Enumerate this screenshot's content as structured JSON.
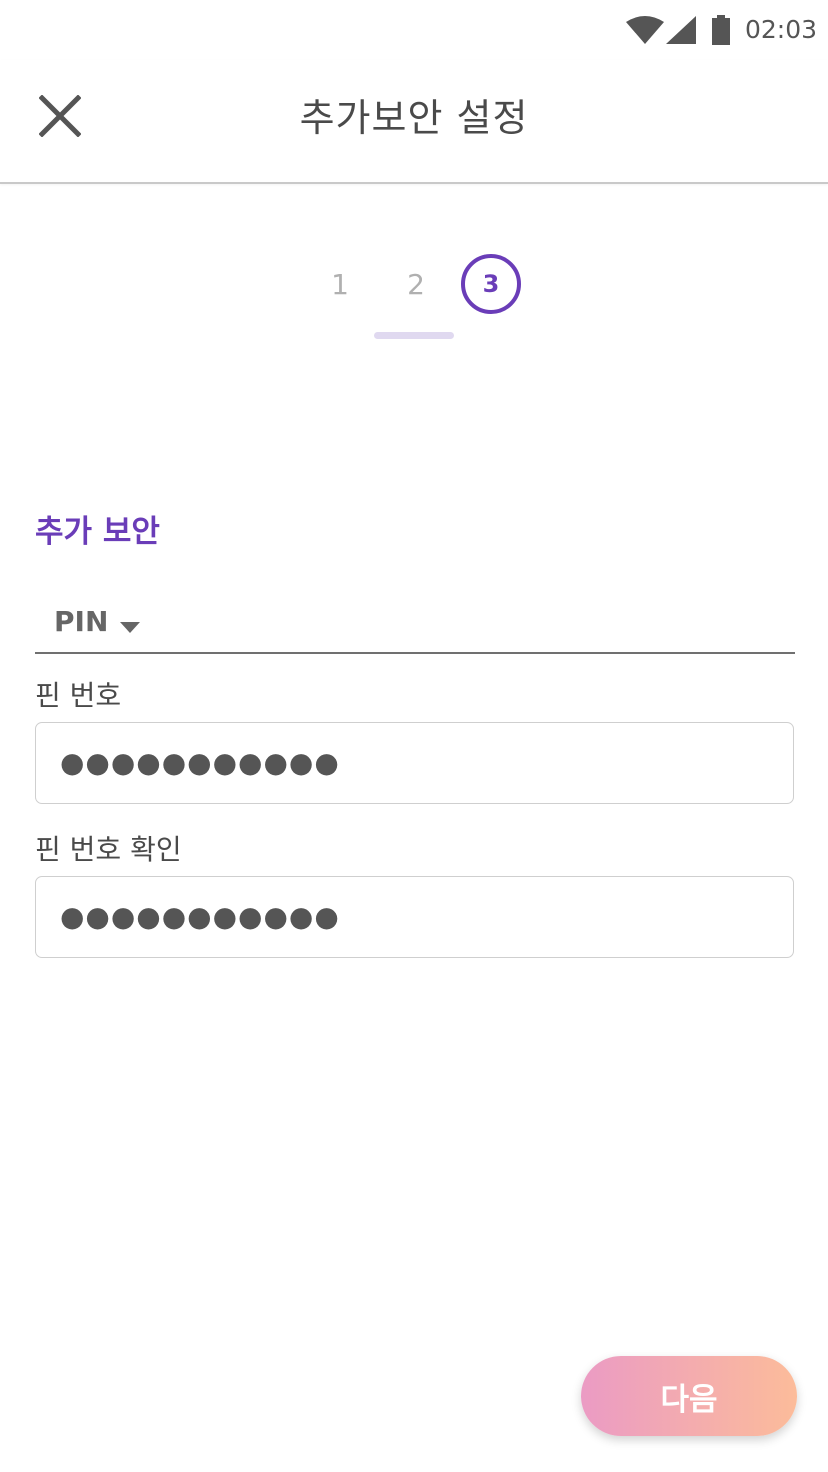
{
  "status_bar": {
    "time": "02:03",
    "icons": [
      "wifi-icon",
      "signal-icon",
      "battery-icon"
    ]
  },
  "header": {
    "title": "추가보안 설정",
    "close_icon": "close-icon"
  },
  "stepper": {
    "steps": [
      "1",
      "2",
      "3"
    ],
    "current_step": 3
  },
  "section": {
    "title": "추가 보안"
  },
  "security_type": {
    "selected": "PIN",
    "caret_icon": "caret-down-icon"
  },
  "pin": {
    "label": "핀 번호",
    "value": "●●●●●●●●●●●"
  },
  "pin_confirm": {
    "label": "핀 번호 확인",
    "value": "●●●●●●●●●●●"
  },
  "next_button": {
    "label": "다음"
  },
  "colors": {
    "accent": "#6a3db8",
    "step_indicator": "#e0d9f0",
    "button_gradient_start": "#eb9bc4",
    "button_gradient_end": "#fcbc9a"
  }
}
